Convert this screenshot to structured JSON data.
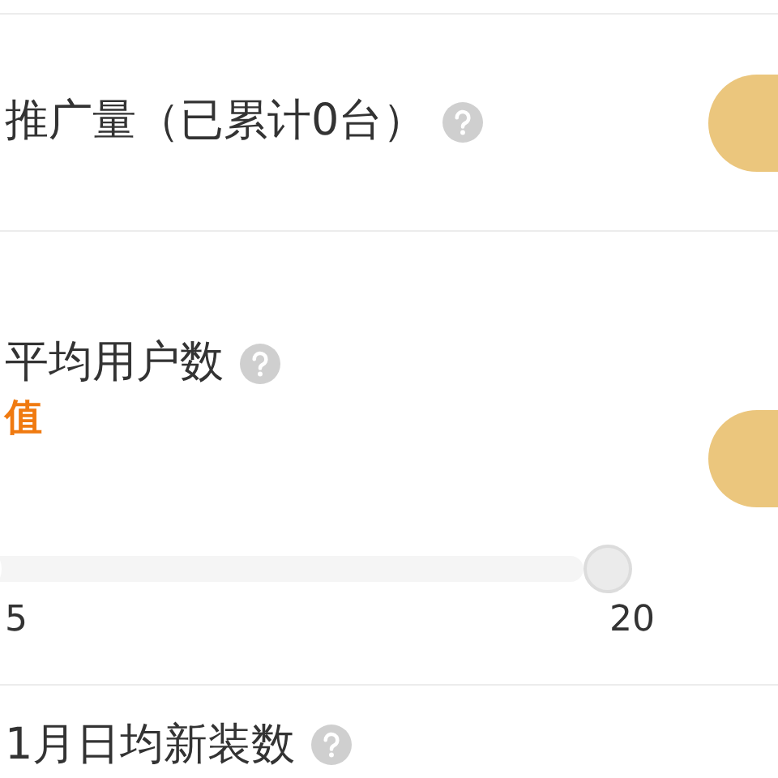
{
  "sections": [
    {
      "kind": "with-button",
      "title": "推广量（已累计0台）"
    },
    {
      "kind": "with-button",
      "title": "平均用户数",
      "note": "值",
      "slider": {
        "level": 0,
        "min_label": "5",
        "max_label": "20"
      }
    },
    {
      "kind": "title-only",
      "title": "1月日均新装数"
    }
  ]
}
